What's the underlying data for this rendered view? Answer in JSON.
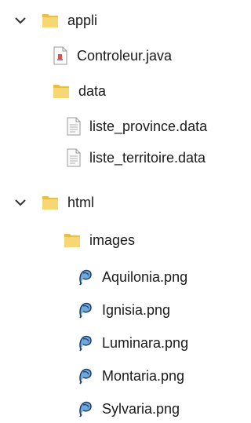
{
  "tree": {
    "appli": {
      "label": "appli",
      "icon": "folder-icon",
      "expanded": true
    },
    "controleur": {
      "label": "Controleur.java",
      "icon": "java-file-icon"
    },
    "data": {
      "label": "data",
      "icon": "folder-icon"
    },
    "liste_province": {
      "label": "liste_province.data",
      "icon": "data-file-icon"
    },
    "liste_territoire": {
      "label": "liste_territoire.data",
      "icon": "data-file-icon"
    },
    "html": {
      "label": "html",
      "icon": "folder-icon",
      "expanded": true
    },
    "images": {
      "label": "images",
      "icon": "folder-icon"
    },
    "files": [
      {
        "label": "Aquilonia.png",
        "icon": "png-file-icon"
      },
      {
        "label": "Ignisia.png",
        "icon": "png-file-icon"
      },
      {
        "label": "Luminara.png",
        "icon": "png-file-icon"
      },
      {
        "label": "Montaria.png",
        "icon": "png-file-icon"
      },
      {
        "label": "Sylvaria.png",
        "icon": "png-file-icon"
      }
    ]
  },
  "colors": {
    "folder": "#f7d774",
    "folder_dark": "#e8bf45",
    "chevron": "#333333",
    "text": "#1a1a1a"
  }
}
